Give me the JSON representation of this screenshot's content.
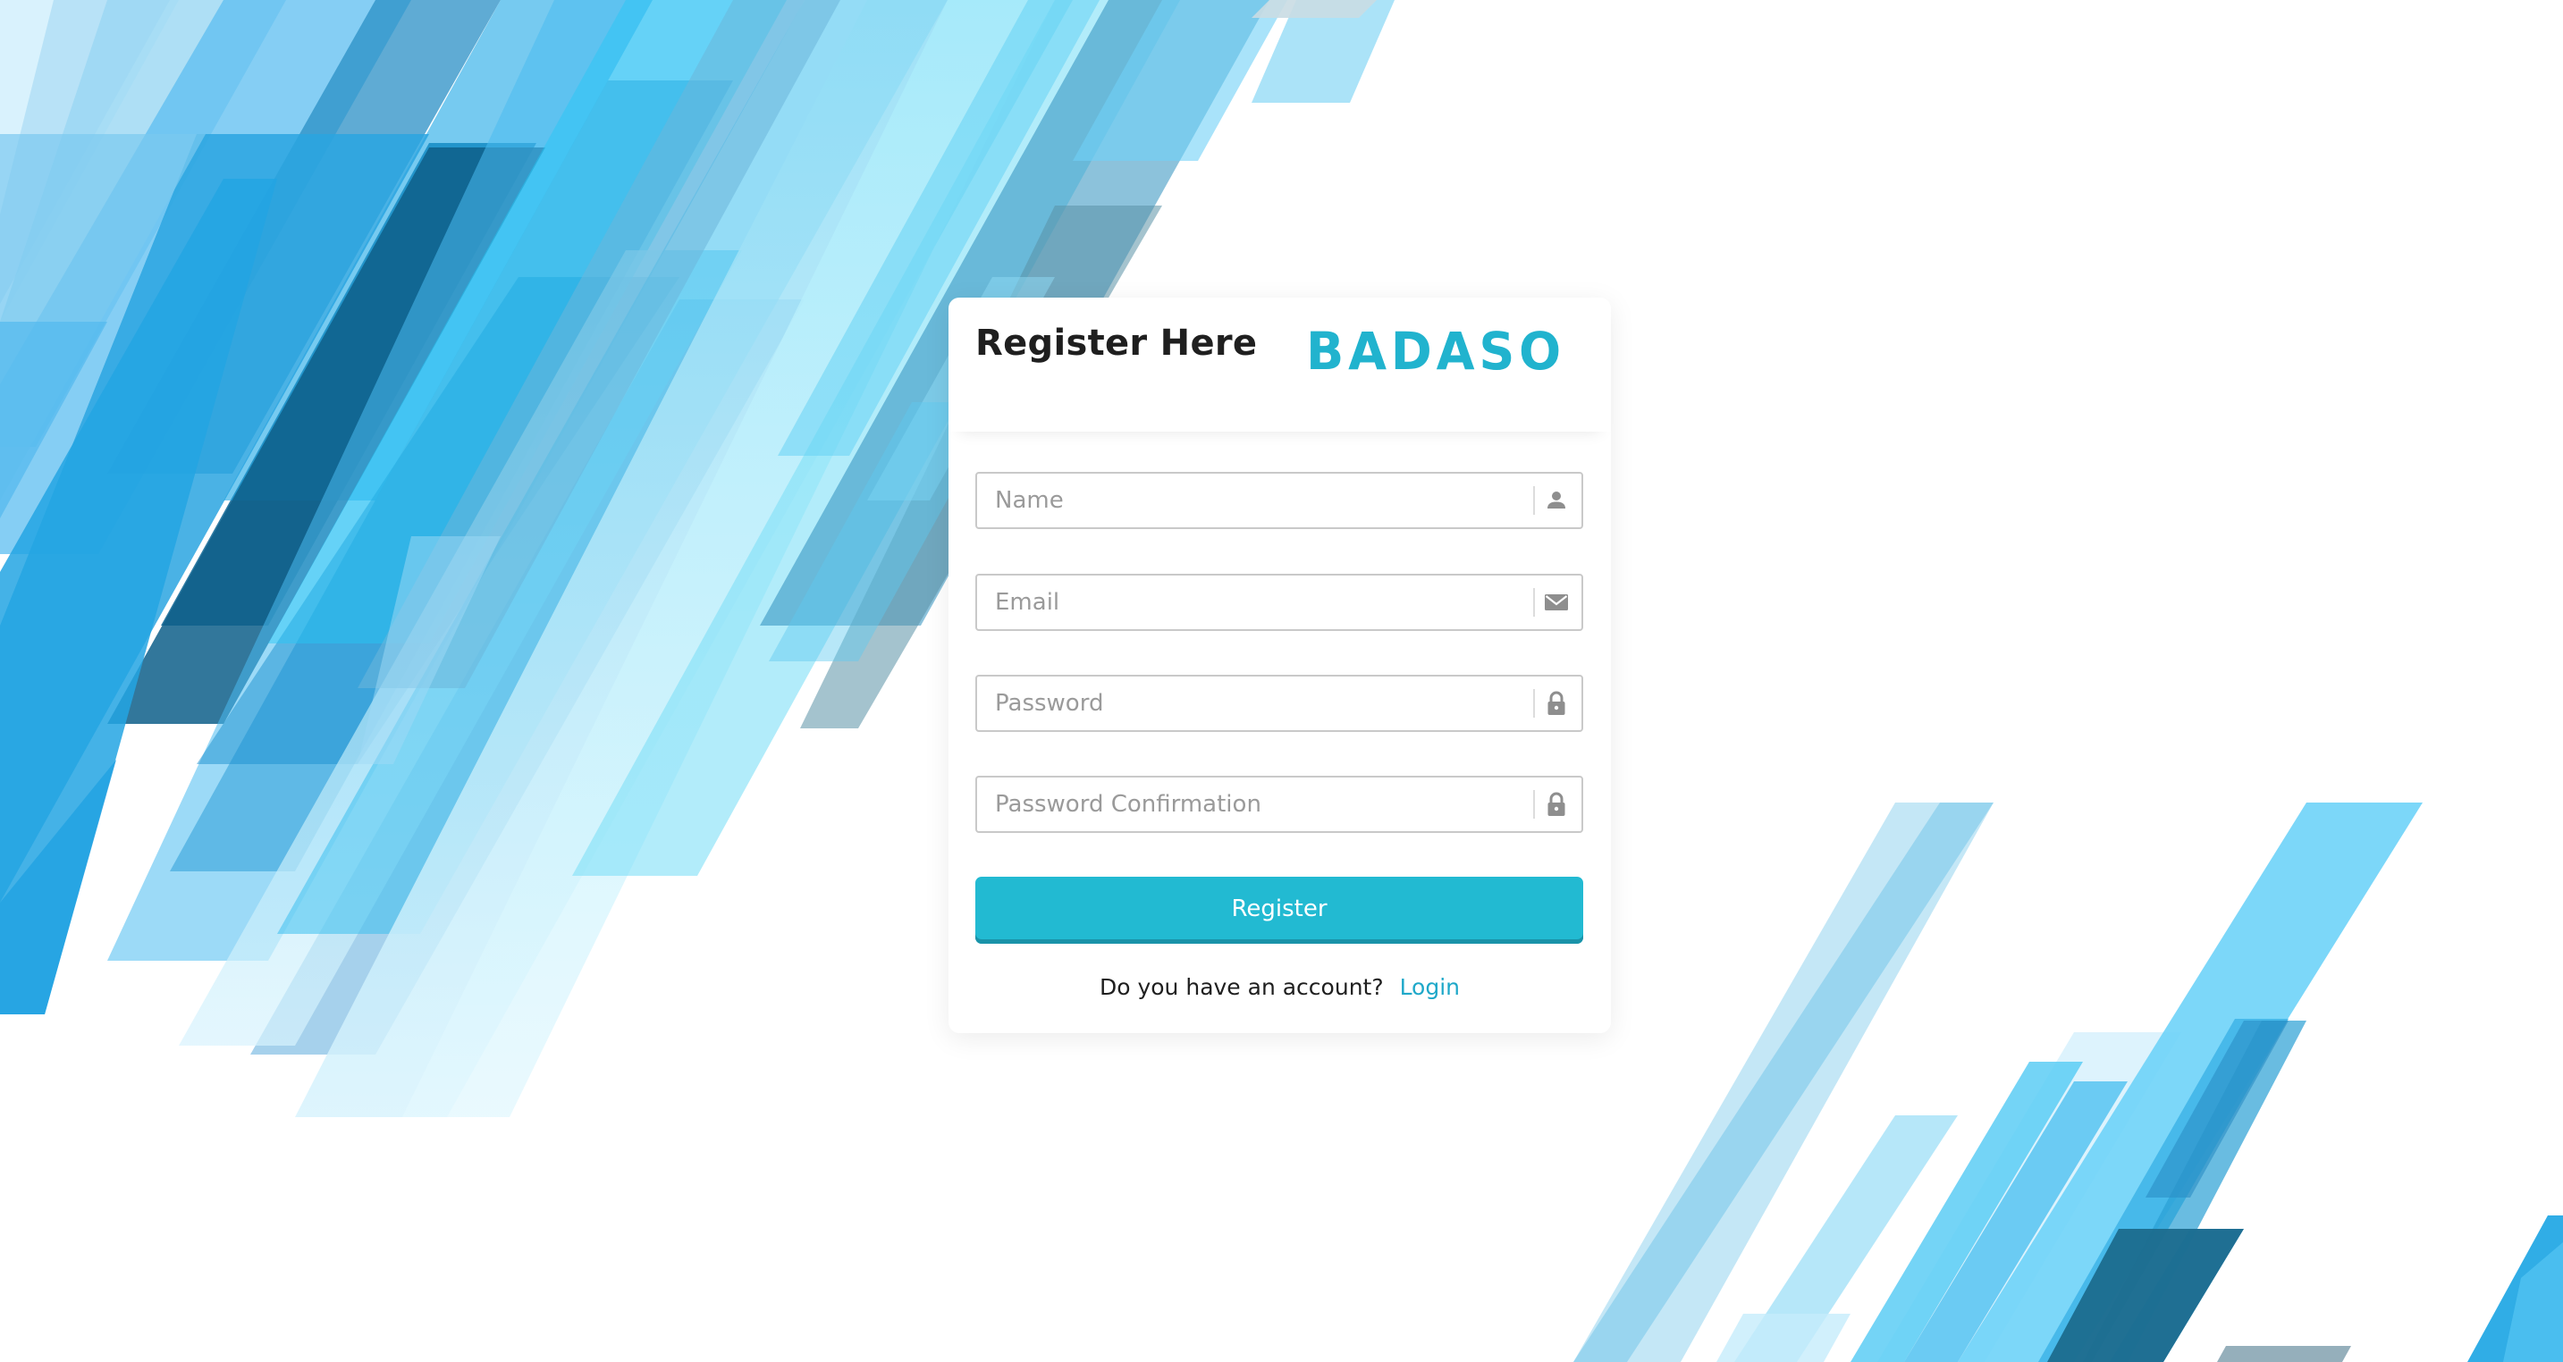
{
  "card": {
    "title": "Register Here",
    "logo_text": "BADASO"
  },
  "form": {
    "name": {
      "placeholder": "Name",
      "icon": "person-icon"
    },
    "email": {
      "placeholder": "Email",
      "icon": "envelope-icon"
    },
    "password": {
      "placeholder": "Password",
      "icon": "lock-icon"
    },
    "password_confirmation": {
      "placeholder": "Password Confirmation",
      "icon": "lock-icon"
    },
    "submit_label": "Register"
  },
  "footer": {
    "question": "Do you have an account?",
    "login_link": "Login"
  },
  "colors": {
    "accent": "#22bad2",
    "link": "#1fa8c9",
    "logo": "#21b3ce"
  }
}
